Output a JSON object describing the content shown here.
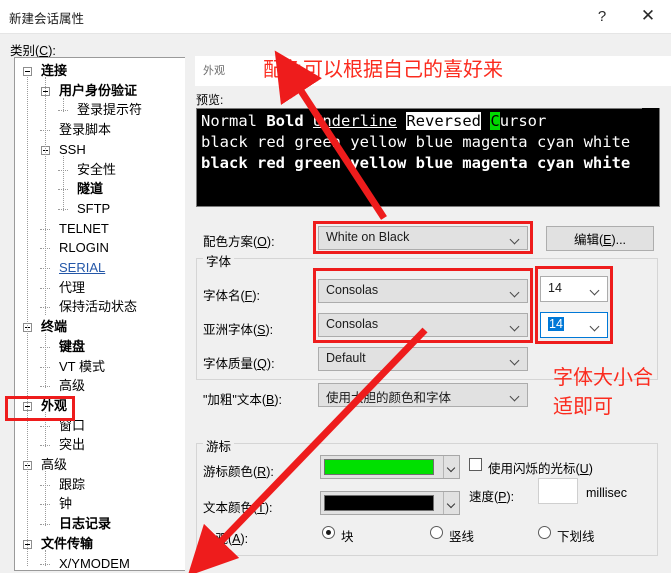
{
  "window": {
    "title": "新建会话属性",
    "help_label": "?",
    "close_label": "✕"
  },
  "category_label": "类别(C):",
  "tree": {
    "items": [
      {
        "label": "连接",
        "level": 0,
        "bold": true,
        "expander": true,
        "link": false
      },
      {
        "label": "用户身份验证",
        "level": 1,
        "bold": true,
        "expander": true,
        "link": false
      },
      {
        "label": "登录提示符",
        "level": 2,
        "bold": false,
        "expander": false,
        "link": false
      },
      {
        "label": "登录脚本",
        "level": 1,
        "bold": false,
        "expander": false,
        "link": false
      },
      {
        "label": "SSH",
        "level": 1,
        "bold": false,
        "expander": true,
        "link": false
      },
      {
        "label": "安全性",
        "level": 2,
        "bold": false,
        "expander": false,
        "link": false
      },
      {
        "label": "隧道",
        "level": 2,
        "bold": true,
        "expander": false,
        "link": false
      },
      {
        "label": "SFTP",
        "level": 2,
        "bold": false,
        "expander": false,
        "link": false
      },
      {
        "label": "TELNET",
        "level": 1,
        "bold": false,
        "expander": false,
        "link": false
      },
      {
        "label": "RLOGIN",
        "level": 1,
        "bold": false,
        "expander": false,
        "link": false
      },
      {
        "label": "SERIAL",
        "level": 1,
        "bold": false,
        "expander": false,
        "link": true
      },
      {
        "label": "代理",
        "level": 1,
        "bold": false,
        "expander": false,
        "link": false
      },
      {
        "label": "保持活动状态",
        "level": 1,
        "bold": false,
        "expander": false,
        "link": false
      },
      {
        "label": "终端",
        "level": 0,
        "bold": true,
        "expander": true,
        "link": false
      },
      {
        "label": "键盘",
        "level": 1,
        "bold": true,
        "expander": false,
        "link": false
      },
      {
        "label": "VT 模式",
        "level": 1,
        "bold": false,
        "expander": false,
        "link": false
      },
      {
        "label": "高级",
        "level": 1,
        "bold": false,
        "expander": false,
        "link": false
      },
      {
        "label": "外观",
        "level": 0,
        "bold": true,
        "expander": true,
        "link": false
      },
      {
        "label": "窗口",
        "level": 1,
        "bold": false,
        "expander": false,
        "link": false
      },
      {
        "label": "突出",
        "level": 1,
        "bold": false,
        "expander": false,
        "link": false
      },
      {
        "label": "高级",
        "level": 0,
        "bold": false,
        "expander": true,
        "link": false
      },
      {
        "label": "跟踪",
        "level": 1,
        "bold": false,
        "expander": false,
        "link": false
      },
      {
        "label": "钟",
        "level": 1,
        "bold": false,
        "expander": false,
        "link": false
      },
      {
        "label": "日志记录",
        "level": 1,
        "bold": true,
        "expander": false,
        "link": false
      },
      {
        "label": "文件传输",
        "level": 0,
        "bold": true,
        "expander": true,
        "link": false
      },
      {
        "label": "X/YMODEM",
        "level": 1,
        "bold": false,
        "expander": false,
        "link": false
      }
    ]
  },
  "tab": {
    "label": "外观"
  },
  "preview": {
    "label": "预览:",
    "line1": {
      "normal": "Normal ",
      "bold": "Bold",
      "sep1": " ",
      "underline": "Underline",
      "sep2": " ",
      "reversed": "Reversed",
      "sep3": " ",
      "cursor_char": "C",
      "cursor_rest": "ursor"
    },
    "line2": "black red green yellow blue magenta cyan white",
    "line3": "black red green yellow blue magenta cyan white"
  },
  "scheme": {
    "label": "配色方案(O):",
    "value": "White on Black",
    "edit_button": "编辑(E)..."
  },
  "font_group": {
    "title": "字体",
    "rows": [
      {
        "label": "字体名(F):",
        "value": "Consolas"
      },
      {
        "label": "亚洲字体(S):",
        "value": "Consolas"
      },
      {
        "label": "字体质量(Q):",
        "value": "Default"
      },
      {
        "label": "\"加粗\"文本(B):",
        "value": "使用大胆的颜色和字体"
      }
    ],
    "size_primary": "14",
    "size_secondary": "14"
  },
  "cursor_group": {
    "title": "游标",
    "color_label": "游标颜色(R):",
    "color_value": "#00e000",
    "text_color_label": "文本颜色(T):",
    "text_color_value": "#000000",
    "appearance_label": "外观(A):",
    "blink_label": "使用闪烁的光标(U)",
    "blink_checked": false,
    "speed_label": "速度(P):",
    "speed_value": "",
    "speed_unit": "millisec",
    "options": [
      {
        "label": "块",
        "selected": true
      },
      {
        "label": "竖线",
        "selected": false
      },
      {
        "label": "下划线",
        "selected": false
      }
    ]
  },
  "annotations": {
    "color_note": "配色可以根据自己的喜好来",
    "font_note_line1": "字体大小合",
    "font_note_line2": "适即可",
    "accent_color": "#ee1c1c"
  }
}
